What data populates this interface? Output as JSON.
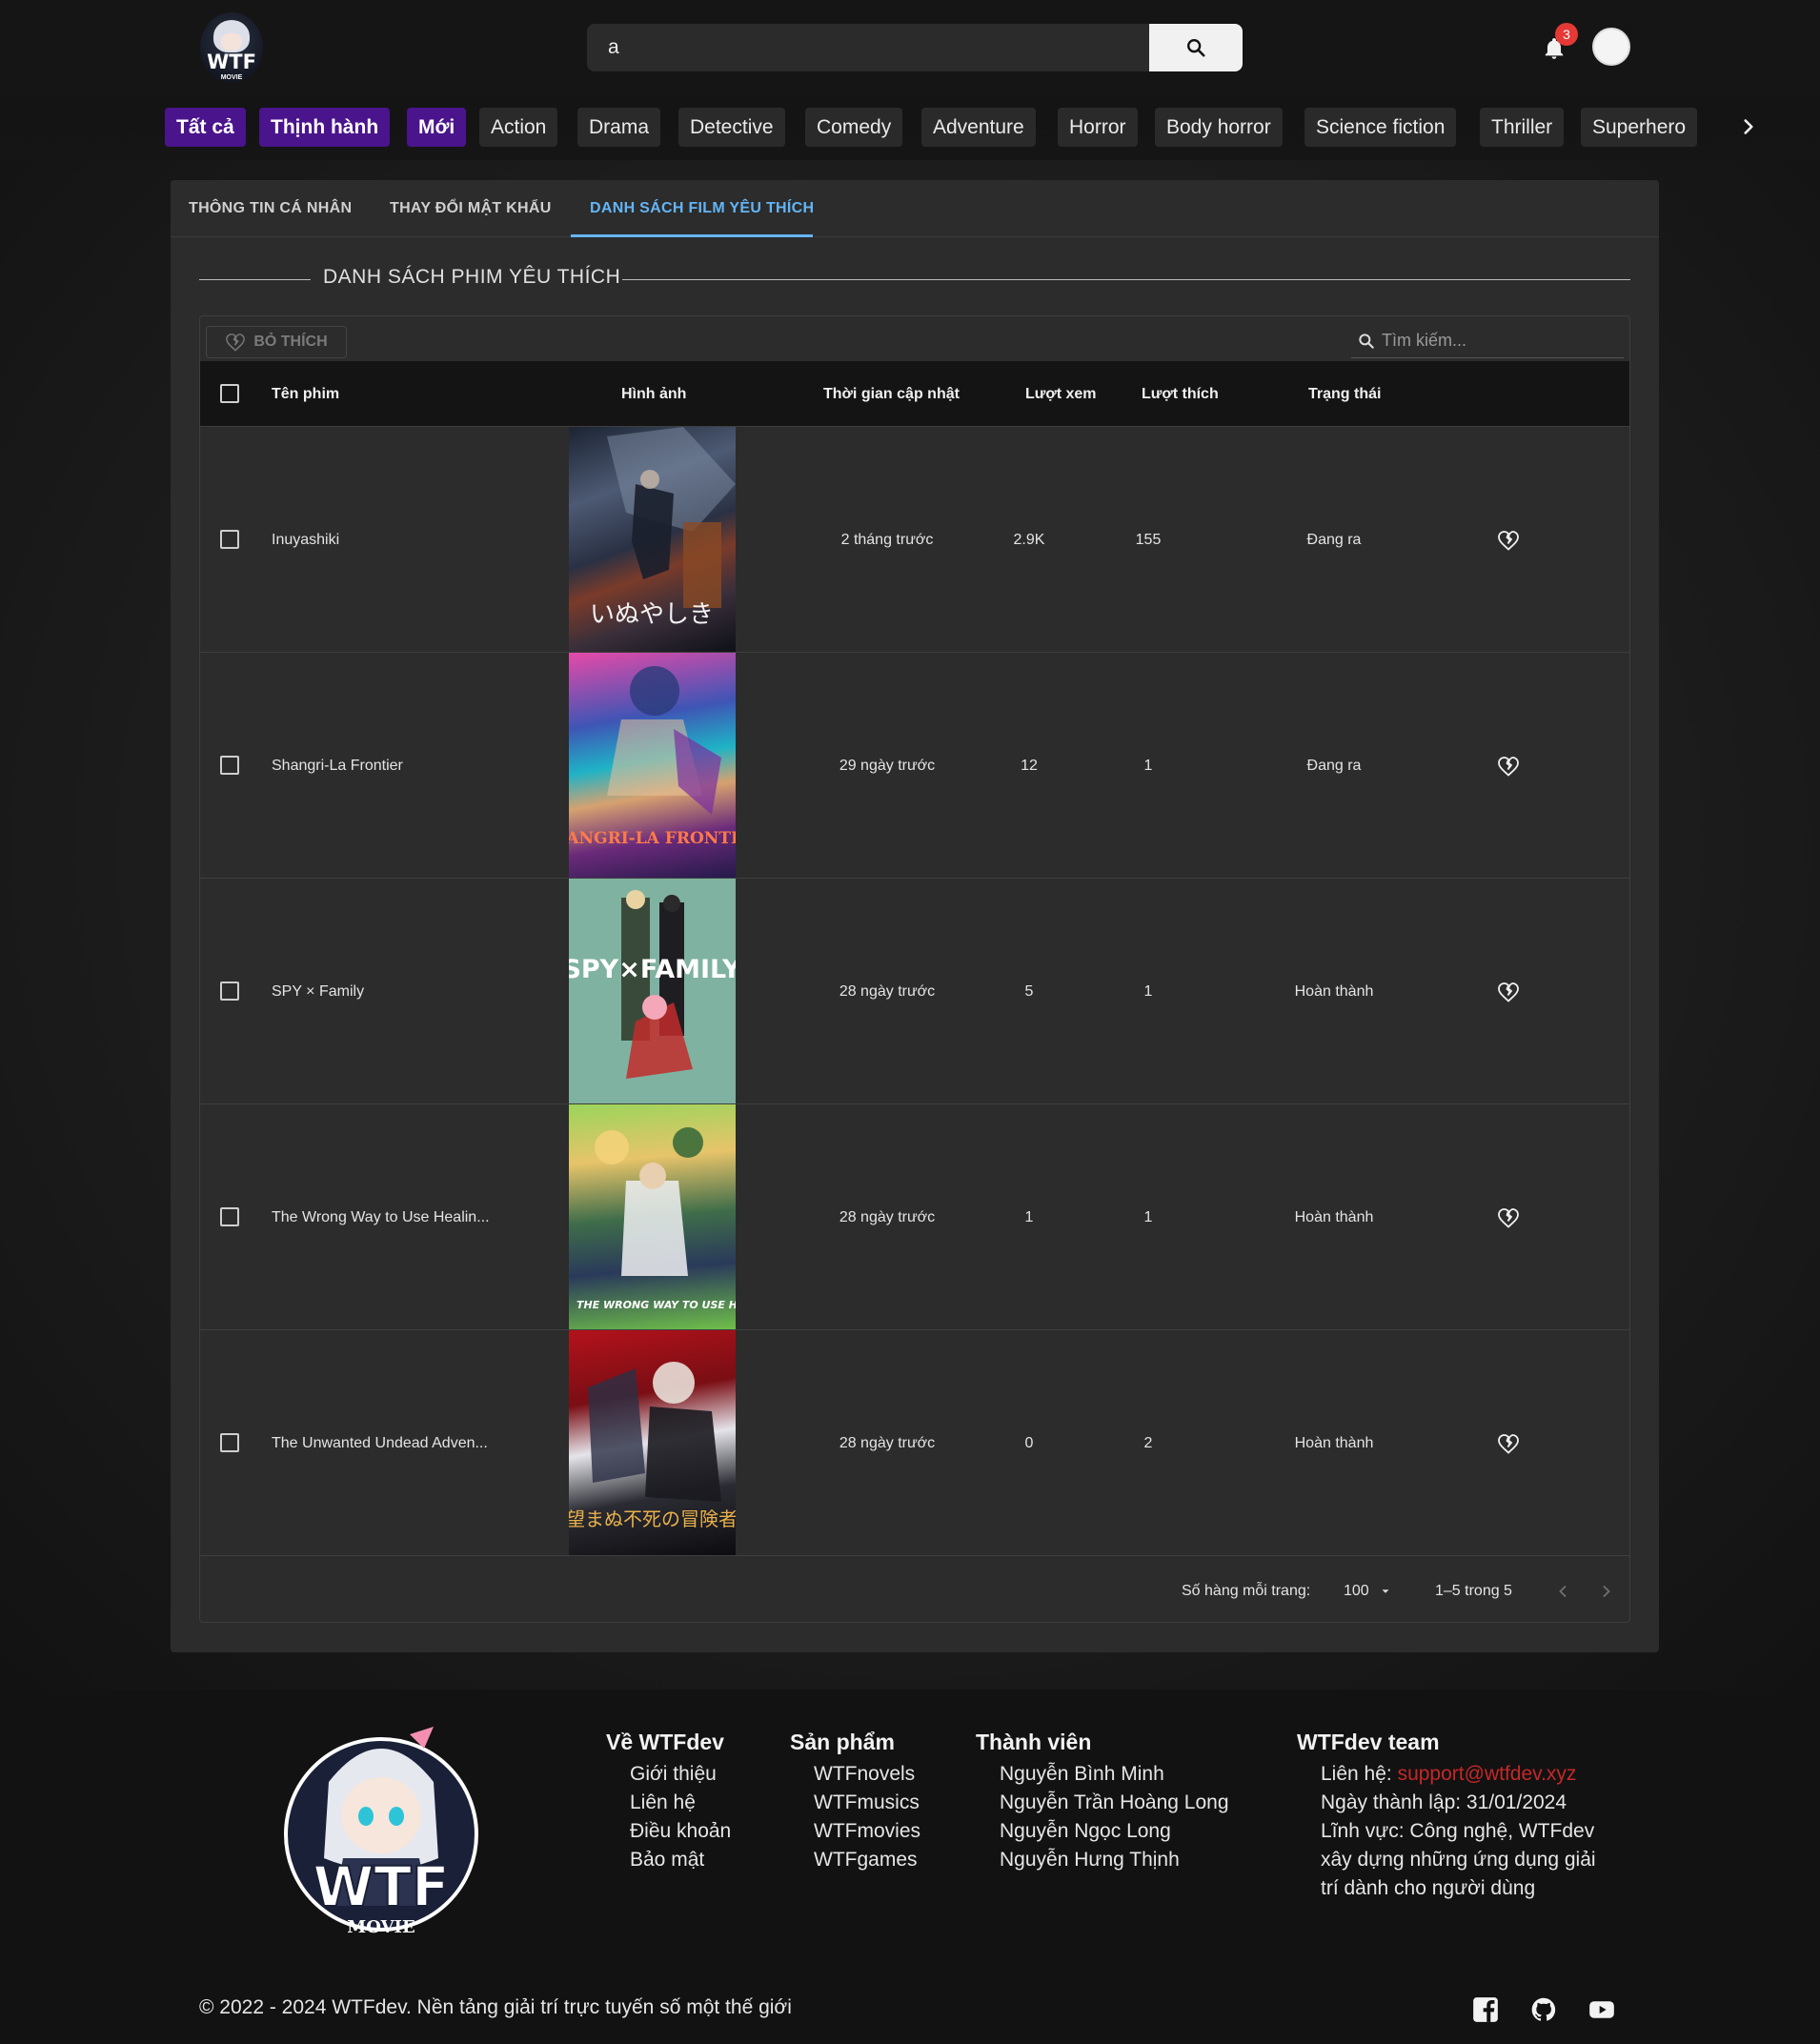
{
  "header": {
    "logo_text": "WTF",
    "logo_sub": "MOVIE",
    "search_value": "a",
    "notification_count": "3"
  },
  "genres": [
    "Tất cả",
    "Thịnh hành",
    "Mới",
    "Action",
    "Drama",
    "Detective",
    "Comedy",
    "Adventure",
    "Horror",
    "Body horror",
    "Science fiction",
    "Thriller",
    "Superhero"
  ],
  "tabs": [
    "THÔNG TIN CÁ NHÂN",
    "THAY ĐỔI MẬT KHẨU",
    "DANH SÁCH FILM YÊU THÍCH"
  ],
  "section_title": "DANH SÁCH PHIM YÊU THÍCH",
  "toolbar": {
    "unlike_label": "BỎ THÍCH",
    "search_placeholder": "Tìm kiếm..."
  },
  "columns": [
    "Tên phim",
    "Hình ảnh",
    "Thời gian cập nhật",
    "Lượt xem",
    "Lượt thích",
    "Trạng thái"
  ],
  "rows": [
    {
      "title": "Inuyashiki",
      "updated": "2 tháng trước",
      "views": "2.9K",
      "likes": "155",
      "status": "Đang ra",
      "poster_text": "いぬやしき"
    },
    {
      "title": "Shangri-La Frontier",
      "updated": "29 ngày trước",
      "views": "12",
      "likes": "1",
      "status": "Đang ra",
      "poster_text": "SHANGRI-LA FRONTIER"
    },
    {
      "title": "SPY × Family",
      "updated": "28 ngày trước",
      "views": "5",
      "likes": "1",
      "status": "Hoàn thành",
      "poster_text": "SPY×FAMILY"
    },
    {
      "title": "The Wrong Way to Use Healin...",
      "updated": "28 ngày trước",
      "views": "1",
      "likes": "1",
      "status": "Hoàn thành",
      "poster_text": "THE WRONG WAY TO USE HEALING MAGIC"
    },
    {
      "title": "The Unwanted Undead Adven...",
      "updated": "28 ngày trước",
      "views": "0",
      "likes": "2",
      "status": "Hoàn thành",
      "poster_text": "望まぬ不死の冒険者"
    }
  ],
  "pagination": {
    "rows_per_page_label": "Số hàng mỗi trang:",
    "rows_per_page": "100",
    "range": "1–5 trong 5"
  },
  "footer": {
    "about": {
      "title": "Về WTFdev",
      "links": [
        "Giới thiệu",
        "Liên hệ",
        "Điều khoản",
        "Bảo mật"
      ]
    },
    "products": {
      "title": "Sản phẩm",
      "links": [
        "WTFnovels",
        "WTFmusics",
        "WTFmovies",
        "WTFgames"
      ]
    },
    "members": {
      "title": "Thành viên",
      "links": [
        "Nguyễn Bình Minh",
        "Nguyễn Trần Hoàng Long",
        "Nguyễn Ngọc Long",
        "Nguyễn Hưng Thịnh"
      ]
    },
    "team": {
      "title": "WTFdev team",
      "contact_label": "Liên hệ: ",
      "contact_email": "support@wtfdev.xyz",
      "founded": "Ngày thành lập: 31/01/2024",
      "field_1": "Lĩnh vực: Công nghệ, WTFdev",
      "field_2": "xây dựng những ứng dụng giải",
      "field_3": "trí dành cho người dùng"
    },
    "copyright": "© 2022 - 2024 WTFdev. Nền tảng giải trí trực tuyến số một thế giới",
    "logo_text": "WTF",
    "logo_sub": "MOVIE"
  },
  "colors": {
    "accent_blue": "#64b5f6",
    "chip_purple": "#4a148c",
    "badge_red": "#e53935",
    "link_red": "#c62828"
  },
  "icons": [
    "search-icon",
    "bell-icon",
    "chevron-right-icon",
    "broken-heart-icon",
    "caret-down-icon",
    "chevron-left-icon",
    "facebook-icon",
    "github-icon",
    "youtube-icon"
  ]
}
